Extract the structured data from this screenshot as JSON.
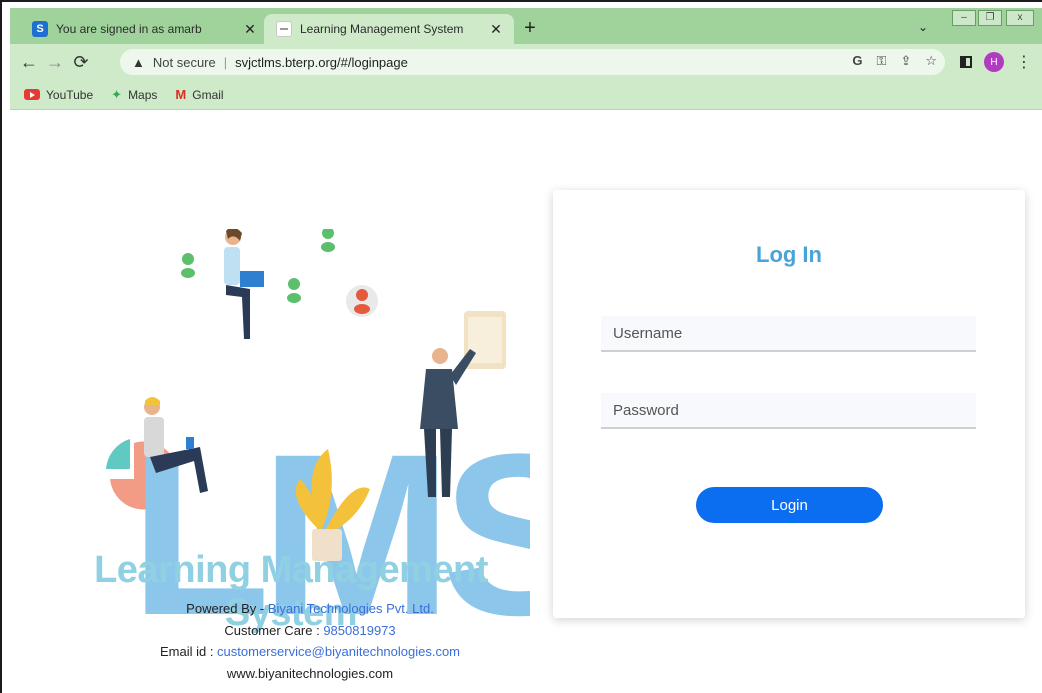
{
  "browser": {
    "tabs": [
      {
        "title": "You are signed in as amarb",
        "favicon": "S",
        "active": false
      },
      {
        "title": "Learning Management System",
        "favicon": "doc",
        "active": true
      }
    ],
    "new_tab": "+",
    "close_glyph": "✕",
    "address": {
      "security_label": "Not secure",
      "url": "svjctlms.bterp.org/#/loginpage"
    },
    "profile_initial": "H",
    "bookmarks": [
      {
        "label": "YouTube",
        "icon": "youtube-icon"
      },
      {
        "label": "Maps",
        "icon": "maps-icon"
      },
      {
        "label": "Gmail",
        "icon": "gmail-icon"
      }
    ],
    "colors": {
      "chrome": "#9fd39b",
      "toolbar": "#cfeac9"
    }
  },
  "page": {
    "illustration_text": "LMS",
    "brand_title": "Learning Management System",
    "powered_by_label": "Powered By - ",
    "powered_by_value": "Biyani Technologies Pvt. Ltd.",
    "customer_care_label": "Customer Care : ",
    "customer_care_value": "9850819973",
    "email_label": "Email id : ",
    "email_value": "customerservice@biyanitechnologies.com",
    "website": "www.biyanitechnologies.com"
  },
  "login": {
    "title": "Log In",
    "username_placeholder": "Username",
    "password_placeholder": "Password",
    "button_label": "Login",
    "accent": "#0b6ef0"
  }
}
